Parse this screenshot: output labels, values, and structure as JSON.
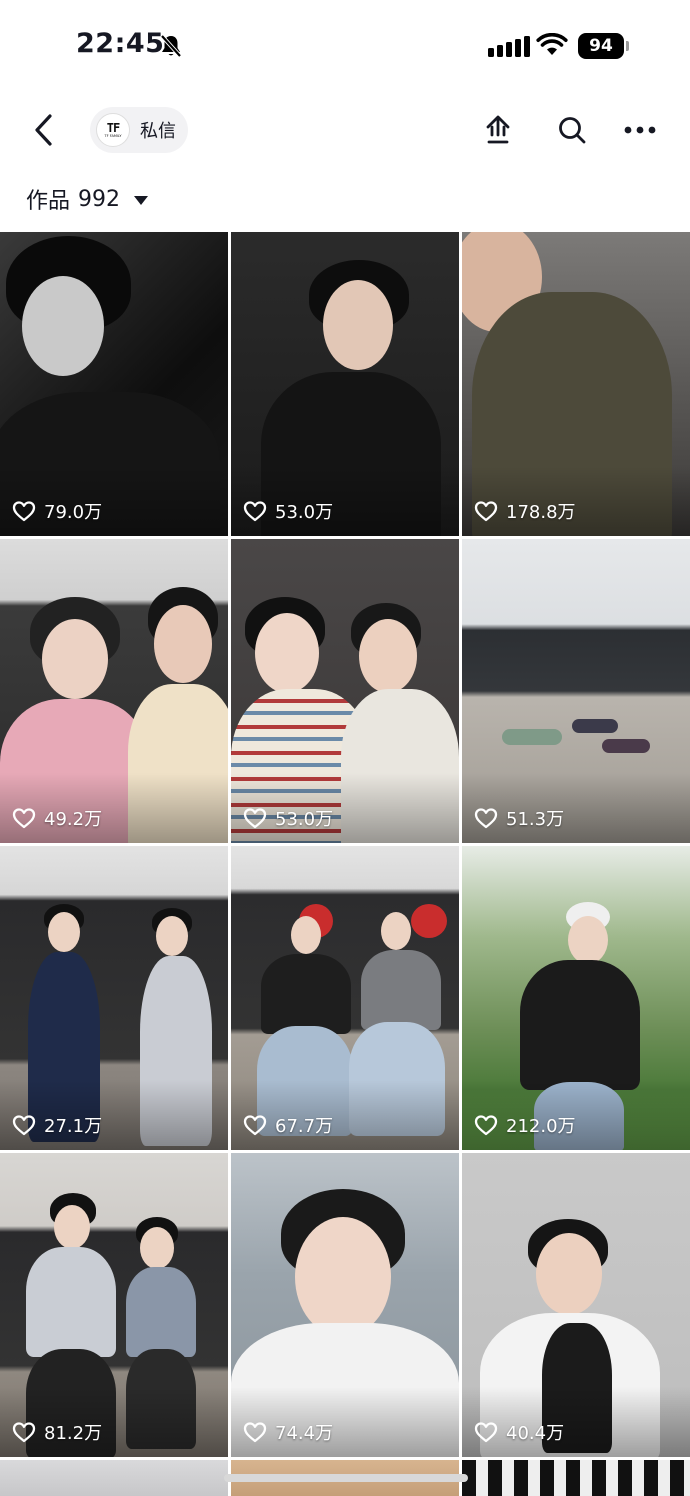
{
  "status_bar": {
    "time": "22:45",
    "battery": "94"
  },
  "nav": {
    "dm_label": "私信",
    "avatar_logo": "TF",
    "avatar_sub": "TF FAMILY"
  },
  "works": {
    "label": "作品",
    "count": "992"
  },
  "videos": [
    {
      "likes": "79.0万"
    },
    {
      "likes": "53.0万"
    },
    {
      "likes": "178.8万"
    },
    {
      "likes": "49.2万"
    },
    {
      "likes": "53.0万"
    },
    {
      "likes": "51.3万"
    },
    {
      "likes": "27.1万"
    },
    {
      "likes": "67.7万"
    },
    {
      "likes": "212.0万"
    },
    {
      "likes": "81.2万"
    },
    {
      "likes": "74.4万"
    },
    {
      "likes": "40.4万"
    }
  ],
  "icons": [
    "bell-mute-icon",
    "signal-icon",
    "wifi-icon",
    "back-arrow-icon",
    "share-icon",
    "search-icon",
    "more-icon",
    "heart-icon"
  ]
}
